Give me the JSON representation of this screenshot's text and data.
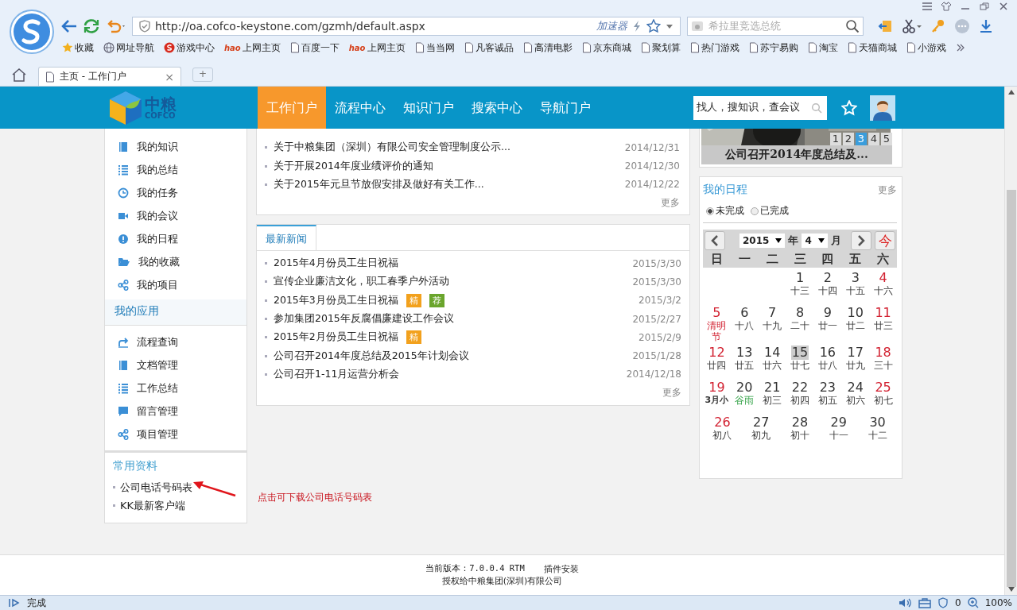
{
  "browser": {
    "address": "http://oa.cofco-keystone.com/gzmh/default.aspx",
    "accelerator": "加速器",
    "search_placeholder": "希拉里竞选总统",
    "bookmarks": [
      {
        "label": "收藏",
        "kind": "star"
      },
      {
        "label": "网址导航",
        "kind": "globe"
      },
      {
        "label": "游戏中心",
        "kind": "game"
      },
      {
        "label": "上网主页",
        "kind": "hao",
        "badge": "hao"
      },
      {
        "label": "百度一下",
        "kind": "page"
      },
      {
        "label": "上网主页",
        "kind": "hao",
        "badge": "hao"
      },
      {
        "label": "当当网",
        "kind": "page"
      },
      {
        "label": "凡客诚品",
        "kind": "page"
      },
      {
        "label": "高清电影",
        "kind": "page"
      },
      {
        "label": "京东商城",
        "kind": "page"
      },
      {
        "label": "聚划算",
        "kind": "page"
      },
      {
        "label": "热门游戏",
        "kind": "page"
      },
      {
        "label": "苏宁易购",
        "kind": "page"
      },
      {
        "label": "淘宝",
        "kind": "page"
      },
      {
        "label": "天猫商城",
        "kind": "page"
      },
      {
        "label": "小游戏",
        "kind": "page"
      }
    ],
    "tabs": [
      {
        "label": "主页 - 工作门户",
        "selected": true,
        "close": "×"
      }
    ],
    "new_tab": "+",
    "status": "完成",
    "ad_count": "0",
    "zoom": "100%"
  },
  "header": {
    "logo_cn": "中粮",
    "logo_en": "COFCO",
    "nav": [
      {
        "label": "工作门户",
        "selected": true
      },
      {
        "label": "流程中心",
        "selected": false
      },
      {
        "label": "知识门户",
        "selected": false
      },
      {
        "label": "搜索中心",
        "selected": false
      },
      {
        "label": "导航门户",
        "selected": false
      }
    ],
    "search_placeholder": "找人，搜知识，查会议"
  },
  "sidebar": {
    "personal": [
      {
        "label": "我的知识",
        "kind": "book"
      },
      {
        "label": "我的总结",
        "kind": "list"
      },
      {
        "label": "我的任务",
        "kind": "clock"
      },
      {
        "label": "我的会议",
        "kind": "video"
      },
      {
        "label": "我的日程",
        "kind": "alert"
      },
      {
        "label": "我的收藏",
        "kind": "folder"
      },
      {
        "label": "我的项目",
        "kind": "share"
      }
    ],
    "apps_title": "我的应用",
    "apps": [
      {
        "label": "流程查询",
        "kind": "arrow"
      },
      {
        "label": "文档管理",
        "kind": "book"
      },
      {
        "label": "工作总结",
        "kind": "list"
      },
      {
        "label": "留言管理",
        "kind": "chat"
      },
      {
        "label": "项目管理",
        "kind": "share"
      }
    ],
    "docs_title": "常用资料",
    "docs": [
      "公司电话号码表",
      "KK最新客户端"
    ]
  },
  "annotation": "点击可下载公司电话号码表",
  "notices": {
    "rows": [
      {
        "title": "关于中粮集团（深圳）有限公司安全管理制度公示...",
        "date": "2014/12/31"
      },
      {
        "title": "关于开展2014年度业绩评价的通知",
        "date": "2014/12/30"
      },
      {
        "title": "关于2015年元旦节放假安排及做好有关工作...",
        "date": "2014/12/22"
      }
    ],
    "more": "更多"
  },
  "news": {
    "tab": "最新新闻",
    "rows": [
      {
        "title": "2015年4月份员工生日祝福",
        "date": "2015/3/30"
      },
      {
        "title": "宣传企业廉洁文化，职工春季户外活动",
        "date": "2015/3/30"
      },
      {
        "title": "2015年3月份员工生日祝福",
        "date": "2015/3/2",
        "tags": [
          {
            "label": "精",
            "color": "#f2a11d"
          },
          {
            "label": "荐",
            "color": "#6aa52c"
          }
        ]
      },
      {
        "title": "参加集团2015年反腐倡廉建设工作会议",
        "date": "2015/2/27"
      },
      {
        "title": "2015年2月份员工生日祝福",
        "date": "2015/2/9",
        "tags": [
          {
            "label": "精",
            "color": "#f2a11d"
          }
        ]
      },
      {
        "title": "公司召开2014年度总结及2015年计划会议",
        "date": "2015/1/28"
      },
      {
        "title": "公司召开1-11月运营分析会",
        "date": "2014/12/18"
      }
    ],
    "more": "更多"
  },
  "slideshow": {
    "pages": [
      {
        "label": "1",
        "selected": false
      },
      {
        "label": "2",
        "selected": false
      },
      {
        "label": "3",
        "selected": true
      },
      {
        "label": "4",
        "selected": false
      },
      {
        "label": "5",
        "selected": false
      }
    ],
    "caption": "公司召开2014年度总结及..."
  },
  "schedule": {
    "title": "我的日程",
    "more": "更多",
    "filters": [
      {
        "label": "未完成",
        "selected": true
      },
      {
        "label": "已完成",
        "selected": false
      }
    ],
    "calendar": {
      "year": "2015",
      "year_unit": "年",
      "month": "4",
      "month_unit": "月",
      "today_button": "今",
      "weekdays": [
        "日",
        "一",
        "二",
        "三",
        "四",
        "五",
        "六"
      ],
      "weeks": [
        [
          {
            "day": "1",
            "lunar": "十三",
            "weekend": false,
            "kind": "plain",
            "today": false
          },
          {
            "day": "2",
            "lunar": "十四",
            "weekend": false,
            "kind": "plain",
            "today": false
          },
          {
            "day": "3",
            "lunar": "十五",
            "weekend": false,
            "kind": "plain",
            "today": false
          },
          {
            "day": "4",
            "lunar": "十六",
            "weekend": true,
            "kind": "plain",
            "today": false
          }
        ],
        [
          {
            "day": "5",
            "lunar": "清明节",
            "weekend": true,
            "kind": "festival",
            "today": false
          },
          {
            "day": "6",
            "lunar": "十八",
            "weekend": false,
            "kind": "plain",
            "today": false
          },
          {
            "day": "7",
            "lunar": "十九",
            "weekend": false,
            "kind": "plain",
            "today": false
          },
          {
            "day": "8",
            "lunar": "二十",
            "weekend": false,
            "kind": "plain",
            "today": false
          },
          {
            "day": "9",
            "lunar": "廿一",
            "weekend": false,
            "kind": "plain",
            "today": false
          },
          {
            "day": "10",
            "lunar": "廿二",
            "weekend": false,
            "kind": "plain",
            "today": false
          },
          {
            "day": "11",
            "lunar": "廿三",
            "weekend": true,
            "kind": "plain",
            "today": false
          }
        ],
        [
          {
            "day": "12",
            "lunar": "廿四",
            "weekend": true,
            "kind": "plain",
            "today": false
          },
          {
            "day": "13",
            "lunar": "廿五",
            "weekend": false,
            "kind": "plain",
            "today": false
          },
          {
            "day": "14",
            "lunar": "廿六",
            "weekend": false,
            "kind": "plain",
            "today": false
          },
          {
            "day": "15",
            "lunar": "廿七",
            "weekend": false,
            "kind": "plain",
            "today": true
          },
          {
            "day": "16",
            "lunar": "廿八",
            "weekend": false,
            "kind": "plain",
            "today": false
          },
          {
            "day": "17",
            "lunar": "廿九",
            "weekend": false,
            "kind": "plain",
            "today": false
          },
          {
            "day": "18",
            "lunar": "三十",
            "weekend": true,
            "kind": "plain",
            "today": false
          }
        ],
        [
          {
            "day": "19",
            "lunar": "3月小",
            "weekend": true,
            "kind": "month",
            "today": false
          },
          {
            "day": "20",
            "lunar": "谷雨",
            "weekend": false,
            "kind": "term",
            "today": false
          },
          {
            "day": "21",
            "lunar": "初三",
            "weekend": false,
            "kind": "plain",
            "today": false
          },
          {
            "day": "22",
            "lunar": "初四",
            "weekend": false,
            "kind": "plain",
            "today": false
          },
          {
            "day": "23",
            "lunar": "初五",
            "weekend": false,
            "kind": "plain",
            "today": false
          },
          {
            "day": "24",
            "lunar": "初六",
            "weekend": false,
            "kind": "plain",
            "today": false
          },
          {
            "day": "25",
            "lunar": "初七",
            "weekend": true,
            "kind": "plain",
            "today": false
          }
        ],
        [
          {
            "day": "26",
            "lunar": "初八",
            "weekend": true,
            "kind": "plain",
            "today": false
          },
          {
            "day": "27",
            "lunar": "初九",
            "weekend": false,
            "kind": "plain",
            "today": false
          },
          {
            "day": "28",
            "lunar": "初十",
            "weekend": false,
            "kind": "plain",
            "today": false
          },
          {
            "day": "29",
            "lunar": "十一",
            "weekend": false,
            "kind": "plain",
            "today": false
          },
          {
            "day": "30",
            "lunar": "十二",
            "weekend": false,
            "kind": "plain",
            "today": false
          }
        ]
      ]
    }
  },
  "footer": {
    "version": "当前版本：7.0.0.4 RTM",
    "plugin": "插件安装",
    "license": "授权给中粮集团(深圳)有限公司"
  }
}
